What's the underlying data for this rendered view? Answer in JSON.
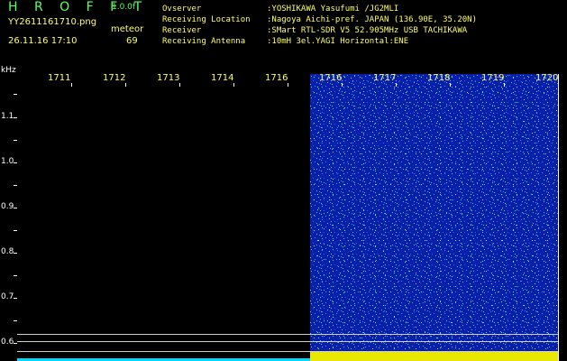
{
  "header": {
    "title": "H R O F F T",
    "version": "1.0.0f",
    "filename": "YY2611161710.png",
    "mode": "meteor",
    "datetime": "26.11.16 17:10",
    "count": "69"
  },
  "info": [
    {
      "key": "Ovserver",
      "value": ":YOSHIKAWA Yasufumi /JG2MLI"
    },
    {
      "key": "Receiving Location",
      "value": ":Nagoya Aichi-pref. JAPAN (136.90E, 35.20N)"
    },
    {
      "key": "Receiver",
      "value": ":SMart RTL-SDR V5 52.905MHz USB TACHIKAWA"
    },
    {
      "key": "Receiving Antenna",
      "value": ":10mH 3el.YAGI Horizontal:ENE"
    }
  ],
  "plot": {
    "y_unit": "kHz",
    "x_ticks": [
      "1711",
      "1712",
      "1713",
      "1714",
      "1716",
      "1716",
      "1717",
      "1718",
      "1719",
      "1720"
    ],
    "y_ticks": [
      "1.1",
      "1.0",
      "0.9",
      "0.8",
      "0.7",
      "0.6"
    ],
    "colors": {
      "background": "#000000",
      "spectrogram": "#0a1aa0",
      "band": "#e8e800",
      "tick_text": "#ffff66",
      "header_green": "#5fff5f"
    }
  }
}
